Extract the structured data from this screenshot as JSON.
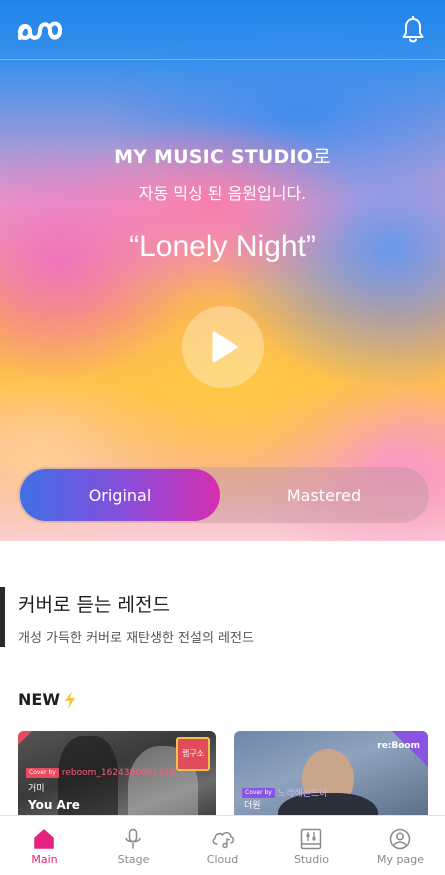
{
  "colors": {
    "accent": "#e6237c",
    "toggle_start": "#3f6fe6",
    "toggle_end": "#d52fb0",
    "text_dark": "#1e1e1e",
    "nav_inactive": "#8a8a8a"
  },
  "header": {
    "logo_icon": "infinity-music-logo-icon",
    "notification_icon": "bell-icon"
  },
  "hero": {
    "brand": "MY MUSIC STUDIO",
    "brand_suffix": "로",
    "subtitle": "자동 믹싱 된 음원입니다.",
    "song_title": "“Lonely Night”",
    "play_icon": "play-icon",
    "toggle": {
      "options": [
        "Original",
        "Mastered"
      ],
      "selected": "Original"
    }
  },
  "legend_section": {
    "title": "커버로 듣는 레전드",
    "subtitle": "개성 가득한 커버로 재탄생한 전설의 레전드"
  },
  "new_section": {
    "title": "NEW",
    "icon": "lightning-icon",
    "cards": [
      {
        "cover_by": "Cover by",
        "cover_user": "reboom_1624380891318",
        "artist": "거미",
        "song": "You Are",
        "badge": "랩구소"
      },
      {
        "cover_by": "Cover by",
        "cover_user": "노래해산드아",
        "artist": "더원",
        "brand": "re:Boom"
      }
    ]
  },
  "bottom_nav": {
    "items": [
      {
        "label": "Main",
        "icon": "home-icon",
        "active": true
      },
      {
        "label": "Stage",
        "icon": "microphone-icon",
        "active": false
      },
      {
        "label": "Cloud",
        "icon": "cloud-music-icon",
        "active": false
      },
      {
        "label": "Studio",
        "icon": "studio-mixer-icon",
        "active": false
      },
      {
        "label": "My page",
        "icon": "user-circle-icon",
        "active": false
      }
    ]
  }
}
